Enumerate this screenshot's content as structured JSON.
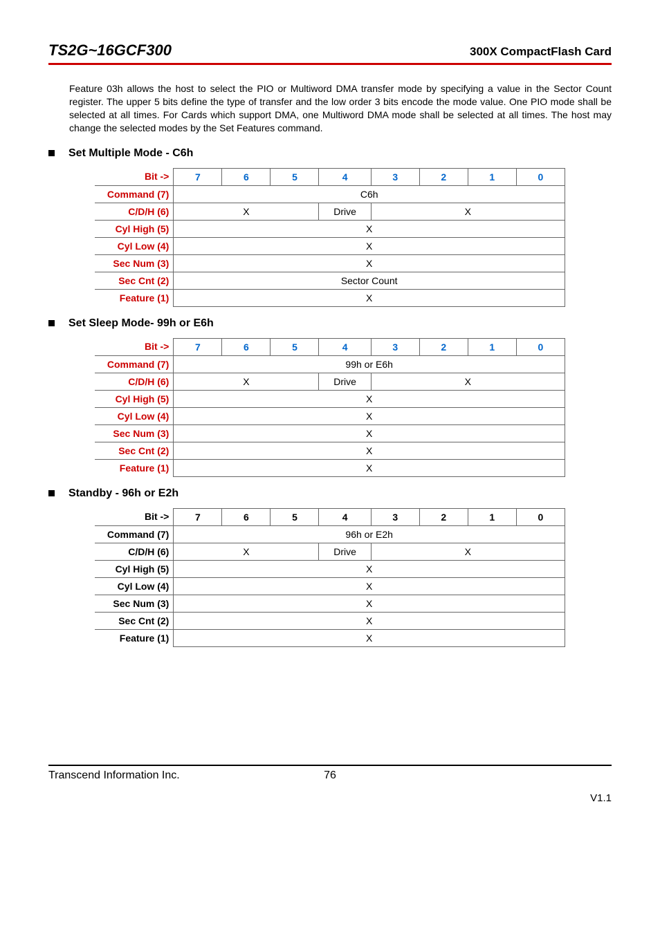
{
  "header": {
    "left": "TS2G~16GCF300",
    "right": "300X CompactFlash Card"
  },
  "paragraph": "Feature 03h allows the host to select the PIO or Multiword DMA transfer mode by specifying a value in the Sector Count register. The upper 5 bits define the type of transfer and the low order 3 bits encode the mode value. One PIO mode shall be selected at all times. For Cards which support DMA, one Multiword DMA mode shall be selected at all times. The host may change the selected modes by the Set Features command.",
  "sections": [
    {
      "title": "Set Multiple Mode - C6h",
      "color": "red",
      "rows": {
        "bit_label": "Bit ->",
        "bits": [
          "7",
          "6",
          "5",
          "4",
          "3",
          "2",
          "1",
          "0"
        ],
        "command_label": "Command (7)",
        "command_value": "C6h",
        "cdh_label": "C/D/H (6)",
        "cdh_left": "X",
        "cdh_drive": "Drive",
        "cdh_right": "X",
        "cylhigh_label": "Cyl High (5)",
        "cylhigh_value": "X",
        "cyllow_label": "Cyl Low (4)",
        "cyllow_value": "X",
        "secnum_label": "Sec Num (3)",
        "secnum_value": "X",
        "seccnt_label": "Sec Cnt (2)",
        "seccnt_value": "Sector Count",
        "feature_label": "Feature (1)",
        "feature_value": "X"
      }
    },
    {
      "title": "Set Sleep Mode- 99h or E6h",
      "color": "red",
      "rows": {
        "bit_label": "Bit ->",
        "bits": [
          "7",
          "6",
          "5",
          "4",
          "3",
          "2",
          "1",
          "0"
        ],
        "command_label": "Command (7)",
        "command_value": "99h or E6h",
        "cdh_label": "C/D/H (6)",
        "cdh_left": "X",
        "cdh_drive": "Drive",
        "cdh_right": "X",
        "cylhigh_label": "Cyl High (5)",
        "cylhigh_value": "X",
        "cyllow_label": "Cyl Low (4)",
        "cyllow_value": "X",
        "secnum_label": "Sec Num (3)",
        "secnum_value": "X",
        "seccnt_label": "Sec Cnt (2)",
        "seccnt_value": "X",
        "feature_label": "Feature (1)",
        "feature_value": "X"
      }
    },
    {
      "title": "Standby - 96h or E2h",
      "color": "black",
      "rows": {
        "bit_label": "Bit ->",
        "bits": [
          "7",
          "6",
          "5",
          "4",
          "3",
          "2",
          "1",
          "0"
        ],
        "command_label": "Command (7)",
        "command_value": "96h or E2h",
        "cdh_label": "C/D/H (6)",
        "cdh_left": "X",
        "cdh_drive": "Drive",
        "cdh_right": "X",
        "cylhigh_label": "Cyl High (5)",
        "cylhigh_value": "X",
        "cyllow_label": "Cyl Low (4)",
        "cyllow_value": "X",
        "secnum_label": "Sec Num (3)",
        "secnum_value": "X",
        "seccnt_label": "Sec Cnt (2)",
        "seccnt_value": "X",
        "feature_label": "Feature (1)",
        "feature_value": "X"
      }
    }
  ],
  "footer": {
    "company": "Transcend Information Inc.",
    "page": "76",
    "version": "V1.1"
  }
}
